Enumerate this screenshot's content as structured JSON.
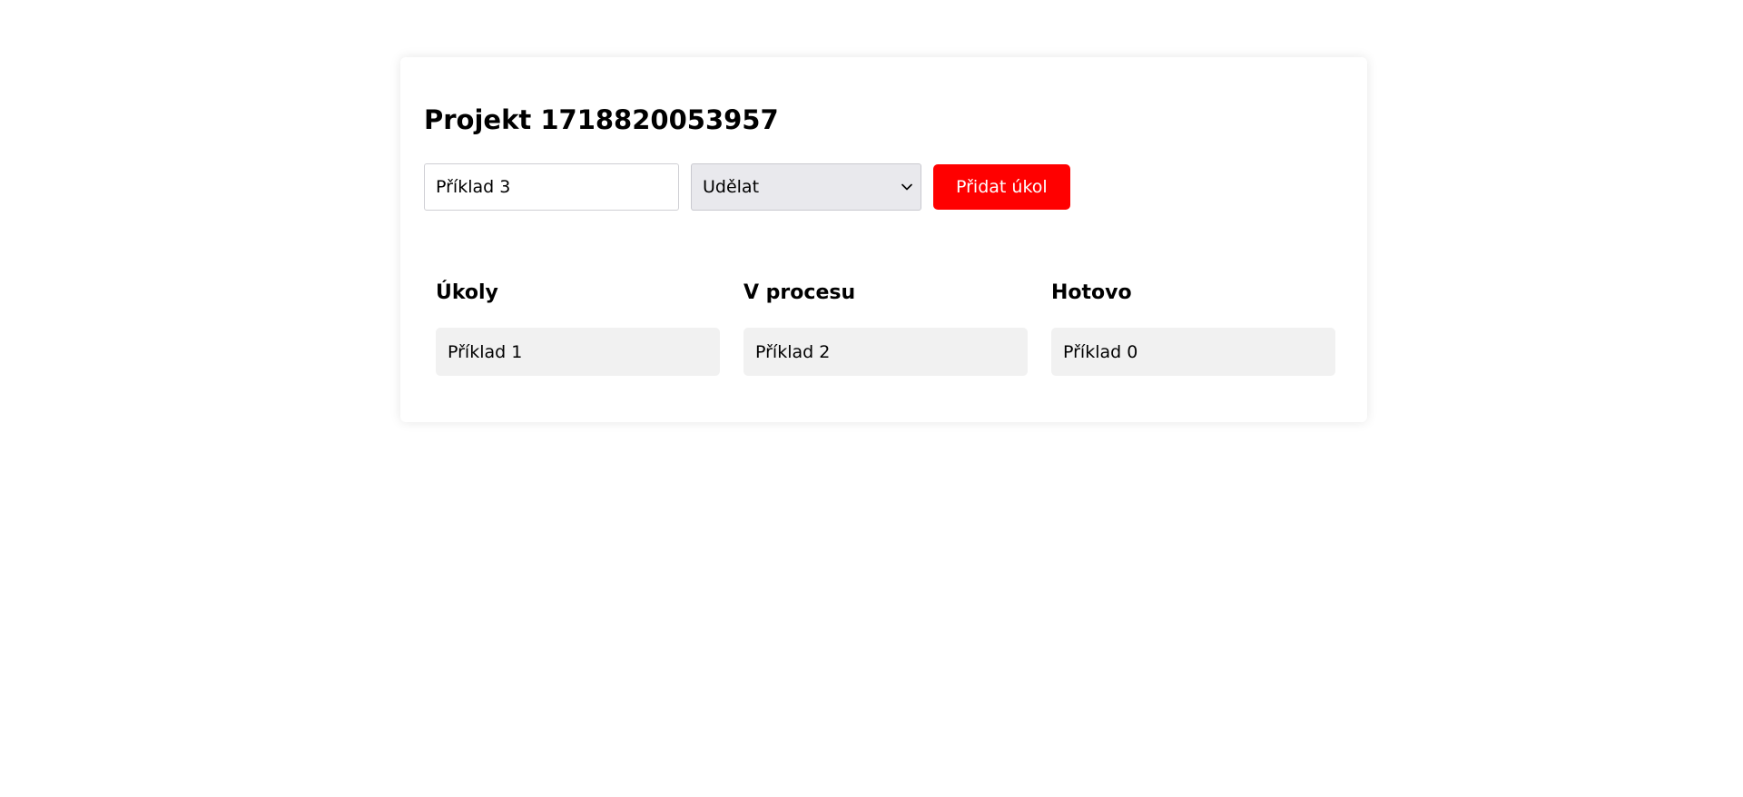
{
  "project": {
    "title": "Projekt 1718820053957"
  },
  "form": {
    "task_input_value": "Příklad 3",
    "status_selected": "Udělat",
    "add_button_label": "Přidat úkol"
  },
  "columns": [
    {
      "title": "Úkoly",
      "tasks": [
        "Příklad 1"
      ]
    },
    {
      "title": "V procesu",
      "tasks": [
        "Příklad 2"
      ]
    },
    {
      "title": "Hotovo",
      "tasks": [
        "Příklad 0"
      ]
    }
  ],
  "icons": {
    "select_arrow": "chevron-down-icon"
  },
  "colors": {
    "accent": "#ff0000",
    "task_background": "#f1f1f1",
    "select_background": "#e9e9ed"
  }
}
